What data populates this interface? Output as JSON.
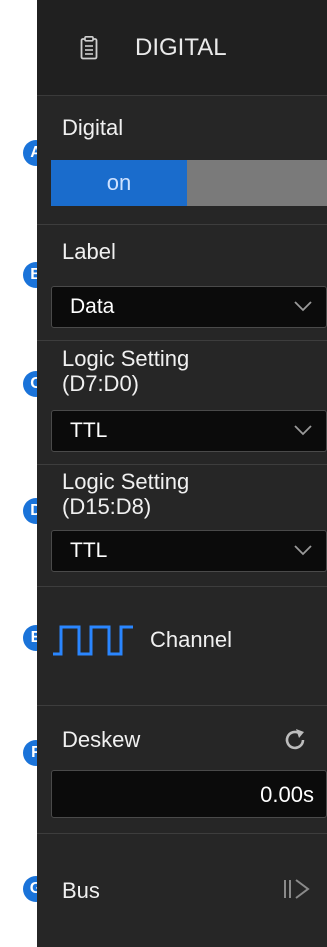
{
  "header": {
    "title": "DIGITAL",
    "icon": "document-icon"
  },
  "badges": [
    "A",
    "B",
    "C",
    "D",
    "E",
    "F",
    "G"
  ],
  "digital": {
    "label": "Digital",
    "toggle_value": "on"
  },
  "label_setting": {
    "label": "Label",
    "value": "Data"
  },
  "logic_low": {
    "label_line1": "Logic Setting",
    "label_line2": "(D7:D0)",
    "value": "TTL"
  },
  "logic_high": {
    "label_line1": "Logic Setting",
    "label_line2": "(D15:D8)",
    "value": "TTL"
  },
  "channel": {
    "label": "Channel",
    "icon": "pulse-wave-icon"
  },
  "deskew": {
    "label": "Deskew",
    "value": "0.00s",
    "icon": "reset-icon"
  },
  "bus": {
    "label": "Bus",
    "icon": "expand-arrow-icon"
  },
  "colors": {
    "accent": "#1a6ccc",
    "badge": "#1a73d9",
    "panel": "#262626"
  }
}
